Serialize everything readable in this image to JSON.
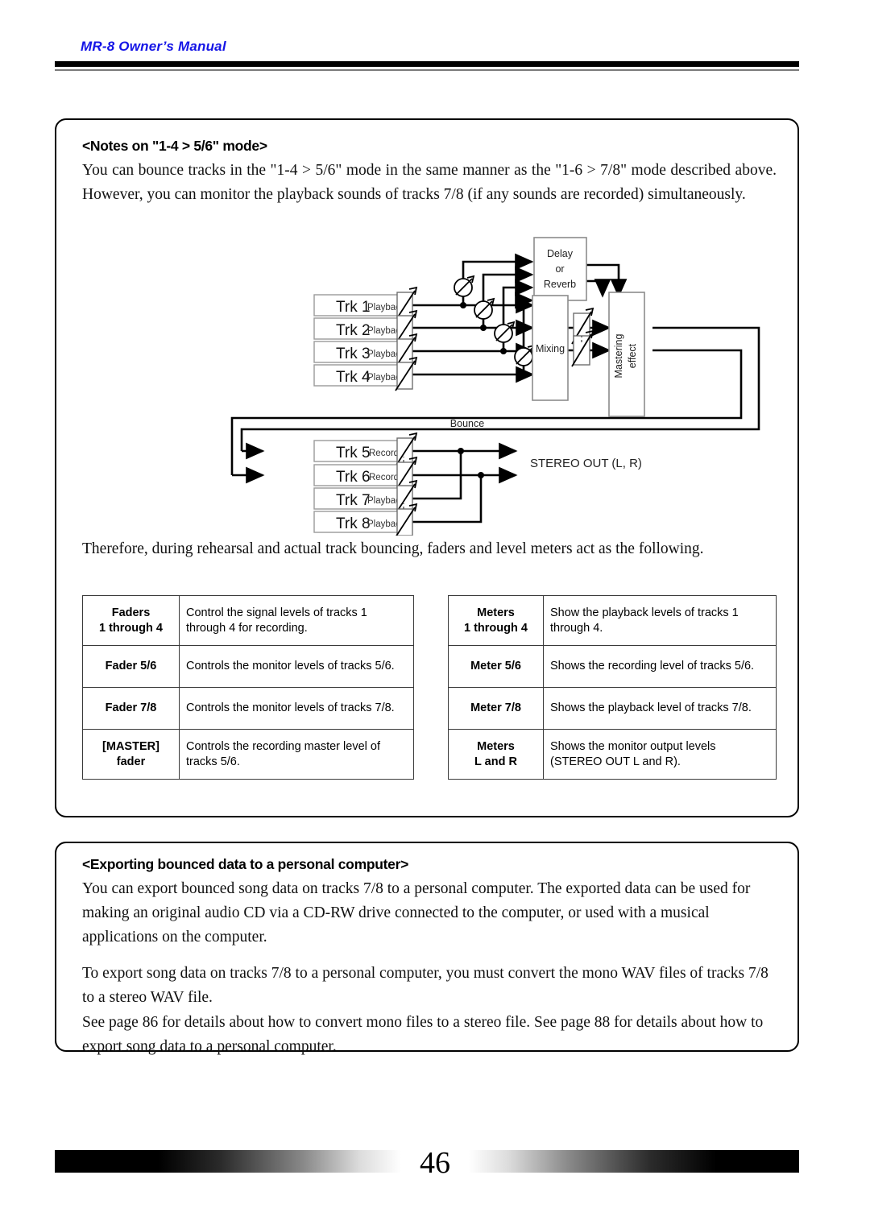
{
  "header": {
    "manual_title": "MR-8 Owner’s Manual"
  },
  "notes_section": {
    "heading": "<Notes on \"1-4 > 5/6\" mode>",
    "intro_paragraph": "You can bounce tracks in the \"1-4 > 5/6\" mode in the same manner as the \"1-6 > 7/8\" mode described above. However, you can monitor the playback sounds of tracks 7/8 (if any sounds are recorded) simultaneously.",
    "therefore_paragraph": "Therefore, during rehearsal and actual track bouncing, faders and level meters act as the following."
  },
  "diagram": {
    "effect_box_lines": [
      "Delay",
      "or",
      "Reverb"
    ],
    "mixing_label": "Mixing",
    "mastering_label_lines": [
      "Mastering",
      "effect"
    ],
    "bounce_label": "Bounce",
    "stereo_out_label": "STEREO OUT (L, R)",
    "tracks": [
      {
        "name": "Trk 1",
        "mode": "Playback"
      },
      {
        "name": "Trk 2",
        "mode": "Playback"
      },
      {
        "name": "Trk 3",
        "mode": "Playback"
      },
      {
        "name": "Trk 4",
        "mode": "Playback"
      },
      {
        "name": "Trk 5",
        "mode": "Record"
      },
      {
        "name": "Trk 6",
        "mode": "Record"
      },
      {
        "name": "Trk 7",
        "mode": "Playback"
      },
      {
        "name": "Trk 8",
        "mode": "Playback"
      }
    ]
  },
  "faders_table": {
    "rows": [
      {
        "key": "Faders\n1 through 4",
        "key_line1": "Faders",
        "key_line2": "1 through 4",
        "value": "Control the signal levels of tracks 1 through 4 for recording."
      },
      {
        "key_line1": "Fader 5/6",
        "key_line2": "",
        "value": "Controls the monitor levels of tracks 5/6."
      },
      {
        "key_line1": "Fader 7/8",
        "key_line2": "",
        "value": "Controls the monitor levels of tracks 7/8."
      },
      {
        "key_line1": "[MASTER]",
        "key_line2": "fader",
        "value": "Controls the recording master level of tracks 5/6."
      }
    ]
  },
  "meters_table": {
    "rows": [
      {
        "key_line1": "Meters",
        "key_line2": "1 through 4",
        "value": "Show the playback levels of tracks 1 through 4."
      },
      {
        "key_line1": "Meter 5/6",
        "key_line2": "",
        "value": "Shows the recording level of tracks 5/6."
      },
      {
        "key_line1": "Meter 7/8",
        "key_line2": "",
        "value": "Shows the playback level of tracks 7/8."
      },
      {
        "key_line1": "Meters",
        "key_line2": "L and R",
        "value": "Shows the monitor output levels (STEREO OUT L and R)."
      }
    ]
  },
  "export_section": {
    "heading": "<Exporting bounced data to a personal computer>",
    "paragraph1": "You can export bounced song data on tracks 7/8 to a personal computer. The exported data can be used for making an original audio CD via a CD-RW drive connected to the computer, or used with a musical applications on the computer.",
    "paragraph2": "To export song data on tracks 7/8 to a personal computer, you must convert the mono WAV files of tracks 7/8 to a stereo WAV file.",
    "paragraph3": "See page 86 for details about how to convert mono files to a stereo file. See page 88 for details about how to export song data to a personal computer."
  },
  "footer": {
    "page_number": "46"
  }
}
